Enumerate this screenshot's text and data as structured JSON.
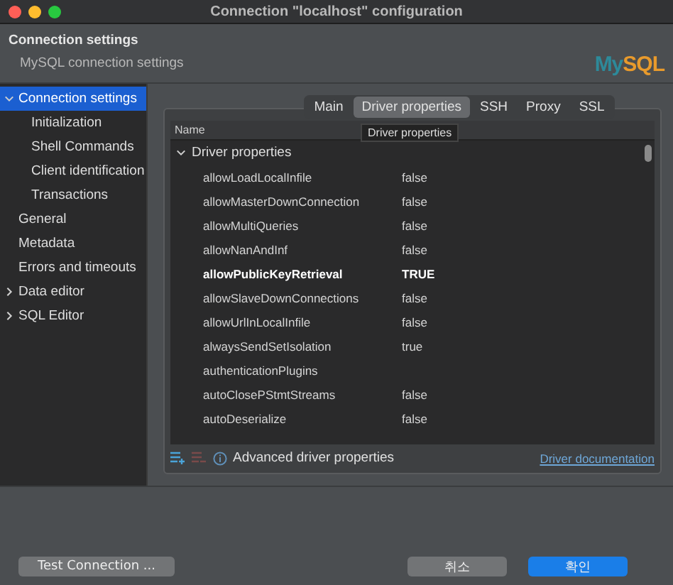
{
  "window": {
    "title": "Connection \"localhost\" configuration"
  },
  "header": {
    "title": "Connection settings",
    "subtitle": "MySQL connection settings",
    "logo": {
      "part1": "My",
      "part2": "SQL"
    }
  },
  "sidebar": {
    "items": [
      {
        "label": "Connection settings",
        "selected": true,
        "expanded": true,
        "children": [
          {
            "label": "Initialization",
            "selected": false
          },
          {
            "label": "Shell Commands",
            "selected": false
          },
          {
            "label": "Client identification",
            "selected": false
          },
          {
            "label": "Transactions",
            "selected": false
          }
        ]
      },
      {
        "label": "General",
        "selected": false
      },
      {
        "label": "Metadata",
        "selected": false
      },
      {
        "label": "Errors and timeouts",
        "selected": false
      },
      {
        "label": "Data editor",
        "selected": false,
        "expanded": false
      },
      {
        "label": "SQL Editor",
        "selected": false,
        "expanded": false
      }
    ]
  },
  "tabs": [
    {
      "label": "Main",
      "selected": false
    },
    {
      "label": "Driver properties",
      "selected": true
    },
    {
      "label": "SSH",
      "selected": false
    },
    {
      "label": "Proxy",
      "selected": false
    },
    {
      "label": "SSL",
      "selected": false
    }
  ],
  "table": {
    "columns": [
      "Name"
    ],
    "tooltip": "Driver properties",
    "group": {
      "label": "Driver properties",
      "expanded": true
    },
    "rows": [
      {
        "name": "allowLoadLocalInfile",
        "value": "false",
        "modified": false
      },
      {
        "name": "allowMasterDownConnection",
        "value": "false",
        "modified": false
      },
      {
        "name": "allowMultiQueries",
        "value": "false",
        "modified": false
      },
      {
        "name": "allowNanAndInf",
        "value": "false",
        "modified": false
      },
      {
        "name": "allowPublicKeyRetrieval",
        "value": "TRUE",
        "modified": true
      },
      {
        "name": "allowSlaveDownConnections",
        "value": "false",
        "modified": false
      },
      {
        "name": "allowUrlInLocalInfile",
        "value": "false",
        "modified": false
      },
      {
        "name": "alwaysSendSetIsolation",
        "value": "true",
        "modified": false
      },
      {
        "name": "authenticationPlugins",
        "modified": false
      },
      {
        "name": "autoClosePStmtStreams",
        "value": "false",
        "modified": false
      },
      {
        "name": "autoDeserialize",
        "value": "false",
        "modified": false
      }
    ]
  },
  "footer": {
    "info": "Advanced driver properties",
    "link": "Driver documentation"
  },
  "buttons": {
    "test": "Test Connection ...",
    "cancel": "취소",
    "ok": "확인"
  }
}
